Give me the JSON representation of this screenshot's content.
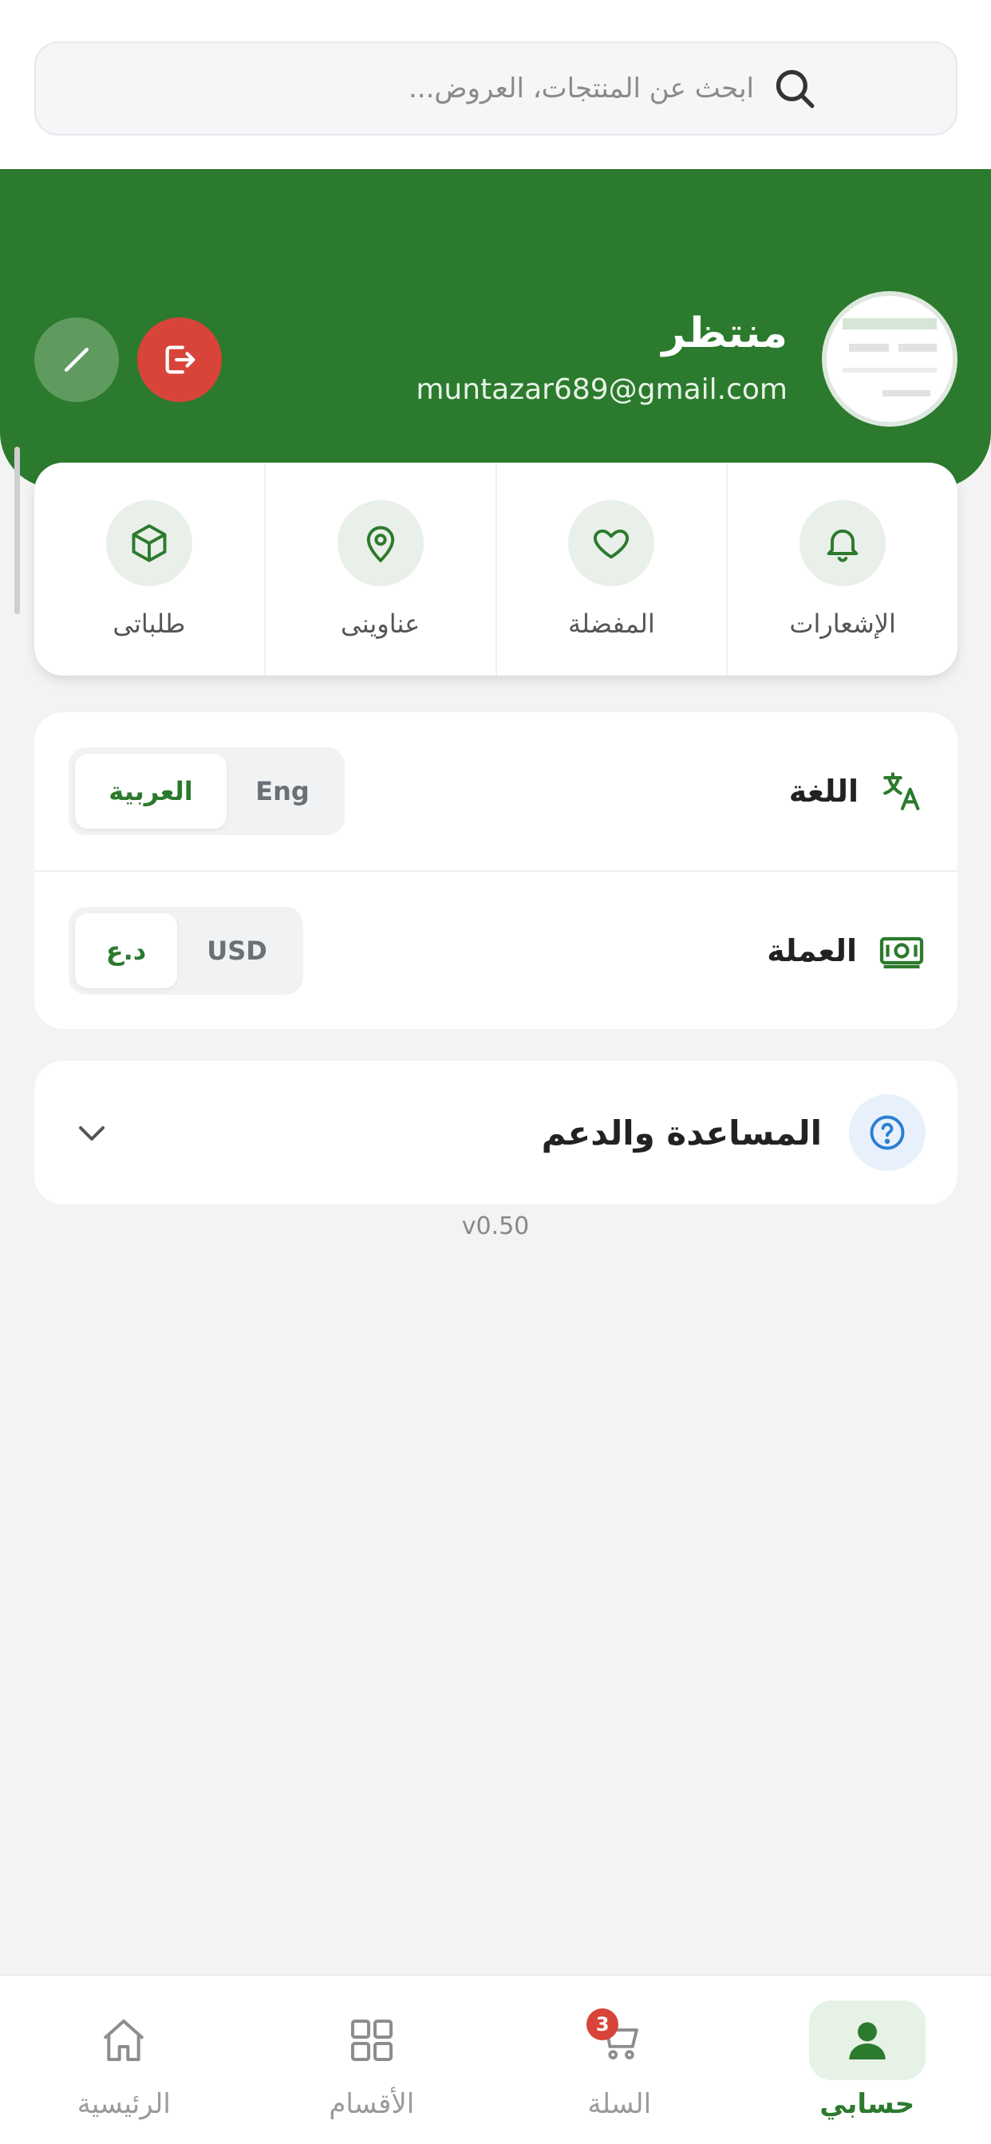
{
  "search": {
    "placeholder": "ابحث عن المنتجات، العروض..."
  },
  "profile": {
    "name": "منتظر",
    "email": "muntazar689@gmail.com"
  },
  "quick_actions": [
    {
      "label": "طلباتى",
      "icon": "box-icon"
    },
    {
      "label": "عناوينى",
      "icon": "location-pin-icon"
    },
    {
      "label": "المفضلة",
      "icon": "heart-icon"
    },
    {
      "label": "الإشعارات",
      "icon": "bell-icon"
    }
  ],
  "settings": {
    "language": {
      "title": "اللغة",
      "icon": "translate-icon",
      "options": [
        "Eng",
        "العربية"
      ],
      "selected": "العربية"
    },
    "currency": {
      "title": "العملة",
      "icon": "money-icon",
      "options": [
        "USD",
        "د.ع"
      ],
      "selected": "د.ع"
    }
  },
  "help": {
    "title": "المساعدة والدعم",
    "icon": "help-circle-icon"
  },
  "version": "v0.50",
  "bottom_nav": [
    {
      "label": "الرئيسية",
      "icon": "home-icon"
    },
    {
      "label": "الأقسام",
      "icon": "grid-icon"
    },
    {
      "label": "السلة",
      "icon": "cart-icon",
      "badge": "3"
    },
    {
      "label": "حسابي",
      "icon": "user-icon",
      "active": true
    }
  ],
  "colors": {
    "primary": "#2c7a2d",
    "danger": "#d9443a",
    "background": "#f3f3f3"
  }
}
